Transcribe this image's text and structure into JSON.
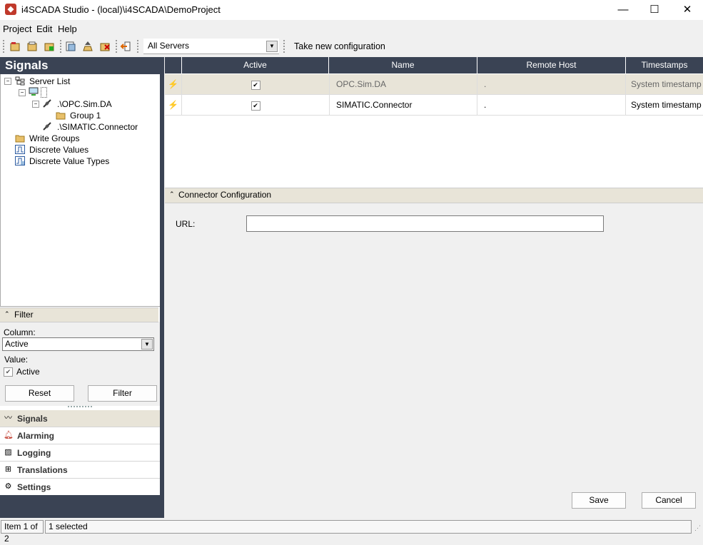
{
  "window": {
    "title": "i4SCADA Studio - (local)\\i4SCADA\\DemoProject",
    "minimize": "—",
    "maximize": "☐",
    "close": "✕"
  },
  "menu": [
    "Project",
    "Edit",
    "Help"
  ],
  "toolbar": {
    "server_select": "All Servers",
    "take_config": "Take new configuration"
  },
  "left_panel": {
    "title": "Signals",
    "tree": {
      "server_list": "Server List",
      "opc_sim_da": ".\\OPC.Sim.DA",
      "group_1": "Group 1",
      "simatic_connector": ".\\SIMATIC.Connector",
      "write_groups": "Write Groups",
      "discrete_values": "Discrete Values",
      "discrete_value_types": "Discrete Value Types"
    },
    "filter": {
      "header": "Filter",
      "column_label": "Column:",
      "column_value": "Active",
      "value_label": "Value:",
      "active_checkbox": "Active",
      "reset": "Reset",
      "filter": "Filter"
    },
    "nav": [
      {
        "label": "Signals",
        "icon": "signals-icon"
      },
      {
        "label": "Alarming",
        "icon": "bell-icon"
      },
      {
        "label": "Logging",
        "icon": "chart-icon"
      },
      {
        "label": "Translations",
        "icon": "translate-icon"
      },
      {
        "label": "Settings",
        "icon": "gear-icon"
      }
    ]
  },
  "grid": {
    "columns": [
      "Active",
      "Name",
      "Remote Host",
      "Timestamps"
    ],
    "rows": [
      {
        "active": true,
        "name": "OPC.Sim.DA",
        "remote_host": ".",
        "timestamps": "System timestamp"
      },
      {
        "active": true,
        "name": "SIMATIC.Connector",
        "remote_host": ".",
        "timestamps": "System timestamp"
      }
    ]
  },
  "connector": {
    "header": "Connector Configuration",
    "url_label": "URL:",
    "url_value": "",
    "save": "Save",
    "cancel": "Cancel"
  },
  "status": {
    "item": "Item 1 of 2",
    "selected": "1 selected"
  },
  "colors": {
    "header_dark": "#3a4354",
    "selected_row": "#e8e4d8",
    "brand_red": "#c0392b"
  }
}
